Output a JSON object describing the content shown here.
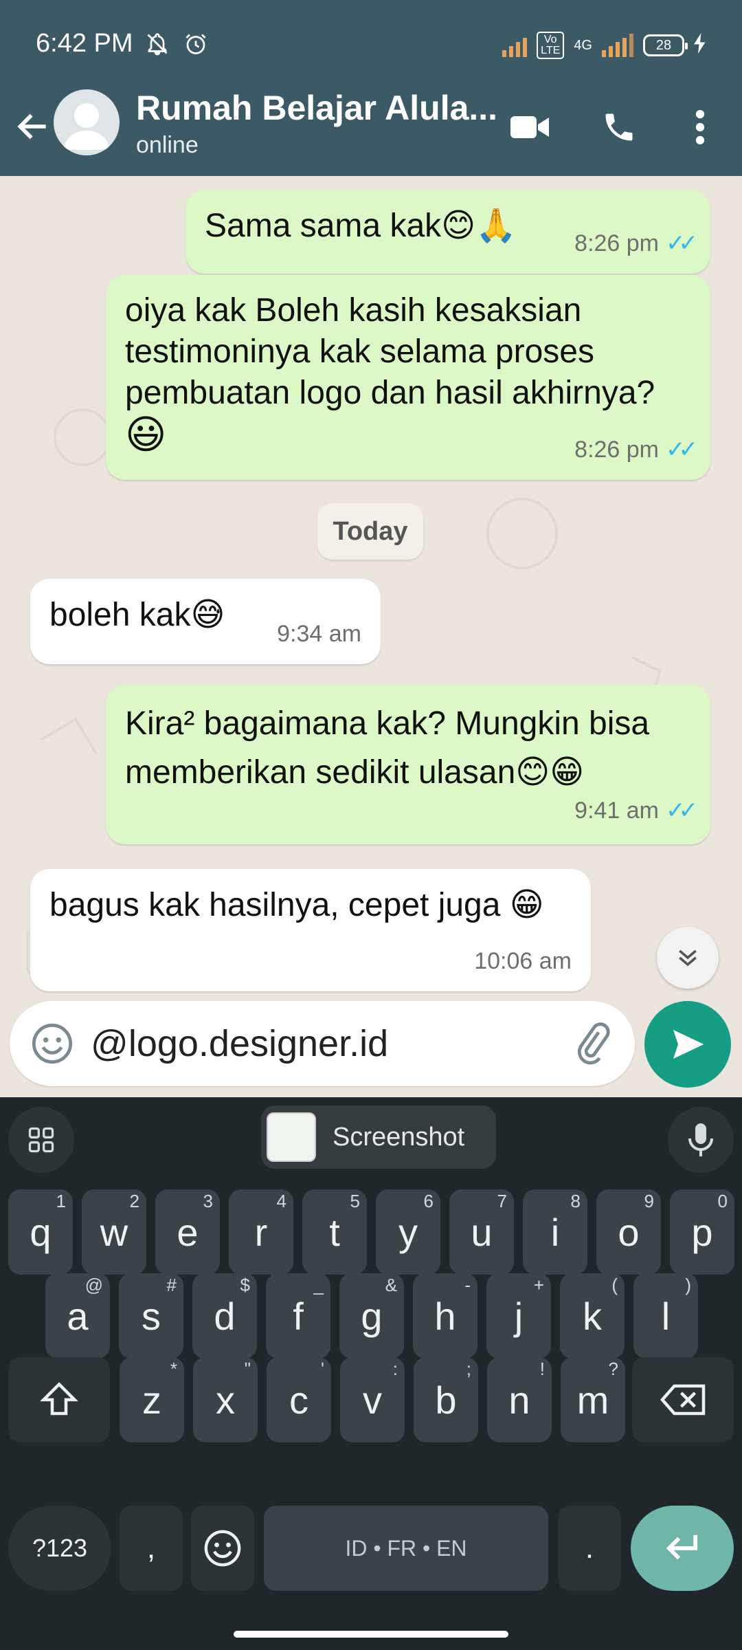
{
  "status_bar": {
    "time": "6:42 PM",
    "volte": "Vo\nLTE",
    "network": "4G",
    "battery": "28"
  },
  "header": {
    "title": "Rumah Belajar Alula...",
    "subtitle": "online"
  },
  "messages": [
    {
      "direction": "out",
      "text": "Sama sama kak",
      "emoji": "😊🙏",
      "time": "8:26 pm",
      "ticks": "✓✓"
    },
    {
      "direction": "out",
      "text": "oiya kak Boleh kasih kesaksian testimoninya kak selama proses pembuatan logo dan hasil akhirnya?",
      "emoji": "😃",
      "time": "8:26 pm",
      "ticks": "✓✓"
    },
    {
      "direction": "in",
      "text": "boleh kak",
      "emoji": "😅",
      "time": "9:34 am"
    },
    {
      "direction": "out",
      "text": "Kira² bagaimana kak? Mungkin bisa memberikan sedikit ulasan",
      "emoji": "😊😁",
      "time": "9:41 am",
      "ticks": "✓✓"
    },
    {
      "direction": "in",
      "text": "bagus kak hasilnya, cepet juga ",
      "emoji": "😁",
      "time": "10:06 am"
    }
  ],
  "date_divider": "Today",
  "composer": {
    "value": "@logo.designer.id"
  },
  "keyboard": {
    "suggestion_chip": "Screenshot",
    "row1": [
      {
        "k": "q",
        "a": "1"
      },
      {
        "k": "w",
        "a": "2"
      },
      {
        "k": "e",
        "a": "3"
      },
      {
        "k": "r",
        "a": "4"
      },
      {
        "k": "t",
        "a": "5"
      },
      {
        "k": "y",
        "a": "6"
      },
      {
        "k": "u",
        "a": "7"
      },
      {
        "k": "i",
        "a": "8"
      },
      {
        "k": "o",
        "a": "9"
      },
      {
        "k": "p",
        "a": "0"
      }
    ],
    "row2": [
      {
        "k": "a",
        "a": "@"
      },
      {
        "k": "s",
        "a": "#"
      },
      {
        "k": "d",
        "a": "$"
      },
      {
        "k": "f",
        "a": "_"
      },
      {
        "k": "g",
        "a": "&"
      },
      {
        "k": "h",
        "a": "-"
      },
      {
        "k": "j",
        "a": "+"
      },
      {
        "k": "k",
        "a": "("
      },
      {
        "k": "l",
        "a": ")"
      }
    ],
    "row3": [
      {
        "k": "z",
        "a": "*"
      },
      {
        "k": "x",
        "a": "\""
      },
      {
        "k": "c",
        "a": "'"
      },
      {
        "k": "v",
        "a": ":"
      },
      {
        "k": "b",
        "a": ";"
      },
      {
        "k": "n",
        "a": "!"
      },
      {
        "k": "m",
        "a": "?"
      }
    ],
    "sym_key": "?123",
    "comma_key": ",",
    "space_label": "ID • FR • EN",
    "period_key": "."
  }
}
